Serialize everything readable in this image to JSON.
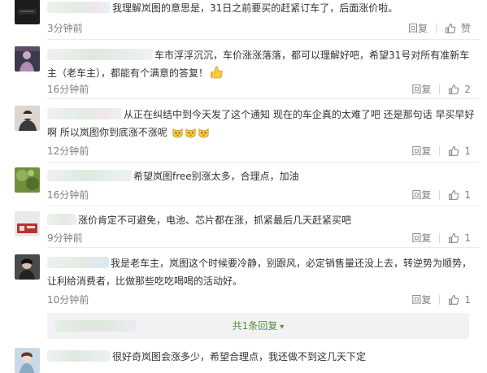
{
  "reply_label": "回复",
  "more_replies_label": "共1条回复",
  "comments": [
    {
      "text": "我理解岚图的意思是，31日之前要买的赶紧订车了，后面涨价啦。",
      "time": "3分钟前",
      "likes": "",
      "liked_label": "赞"
    },
    {
      "text": "车市浮浮沉沉，车价涨涨落落，都可以理解好吧，希望31号对所有准新车主（老车主），都能有个满意的答复！",
      "time": "16分钟前",
      "likes": "2"
    },
    {
      "text": "从正在纠结中到今天发了这个通知 现在的车企真的太难了吧 还是那句话 早买早好啊 所以岚图你到底涨不涨呢",
      "time": "12分钟前",
      "likes": "1"
    },
    {
      "text": "希望岚图free别涨太多，合理点，加油",
      "time": "16分钟前",
      "likes": "1"
    },
    {
      "text": "涨价肯定不可避免，电池、芯片都在涨，抓紧最后几天赶紧买吧",
      "time": "9分钟前",
      "likes": "1"
    },
    {
      "text": "我是老车主，岚图这个时候要冷静，别跟风，必定销售量还没上去，转逆势为顺势，让利给消费者，比做那些吃吃喝喝的活动好。",
      "time": "10分钟前",
      "likes": "1"
    },
    {
      "text": "很好奇岚图会涨多少，希望合理点，我还做不到这几天下定"
    }
  ]
}
